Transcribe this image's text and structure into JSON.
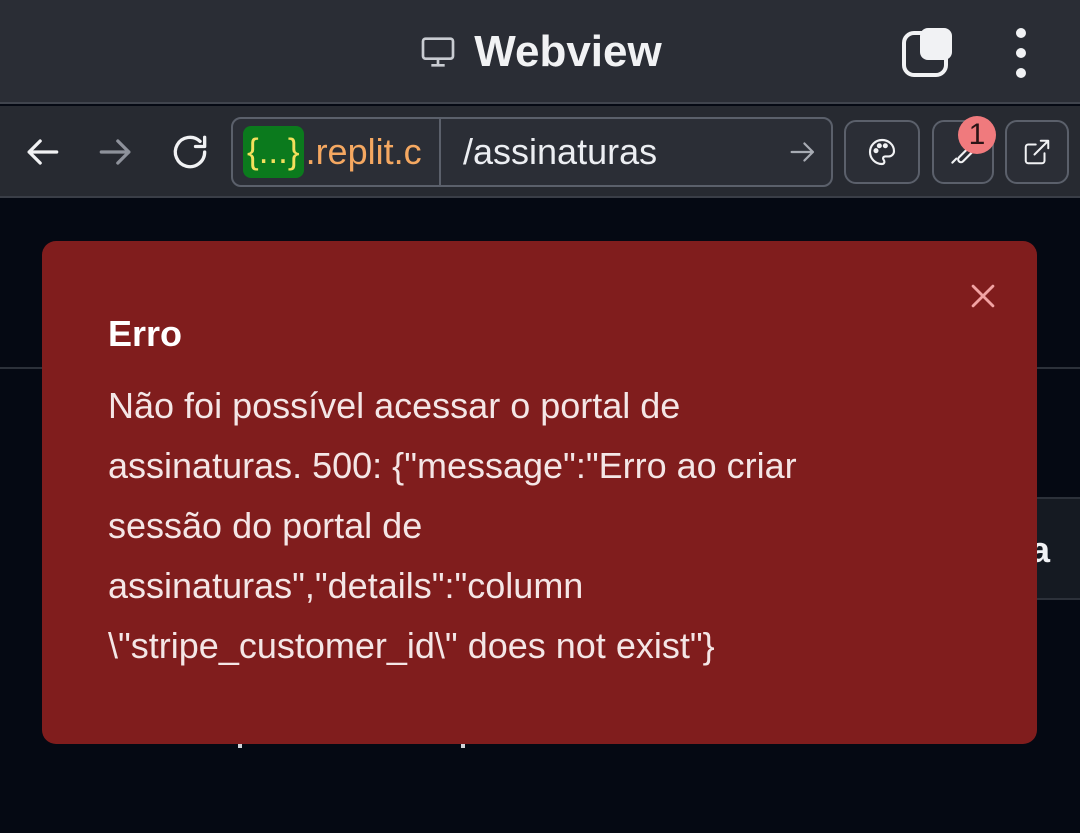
{
  "window": {
    "title": "Webview",
    "title_icon": "monitor-icon",
    "tabs_icon": "tabs-icon",
    "menu_icon": "more-vertical-icon"
  },
  "address_bar": {
    "back_icon": "arrow-left-icon",
    "forward_icon": "arrow-right-icon",
    "reload_icon": "reload-icon",
    "host_badge": "{...}",
    "host": ".replit.c",
    "path": "/assinaturas",
    "go_icon": "arrow-right-icon",
    "theme_icon": "palette-icon",
    "devtools_icon": "wrench-icon",
    "devtools_badge": "1",
    "external_icon": "external-link-icon"
  },
  "background": {
    "partial_text": "a"
  },
  "toast": {
    "title": "Erro",
    "message": "Não foi possível acessar o portal de\nassinaturas. 500: {\"message\":\"Erro ao criar\nsessão do portal de\nassinaturas\",\"details\":\"column\n\\\"stripe_customer_id\\\" does not exist\"}",
    "close_icon": "close-icon"
  },
  "colors": {
    "toast_bg": "#801d1d",
    "page_bg": "#050913",
    "chrome_bg": "#2a2d35",
    "host_color": "#f5a861",
    "badge_color": "#f07a7d"
  }
}
